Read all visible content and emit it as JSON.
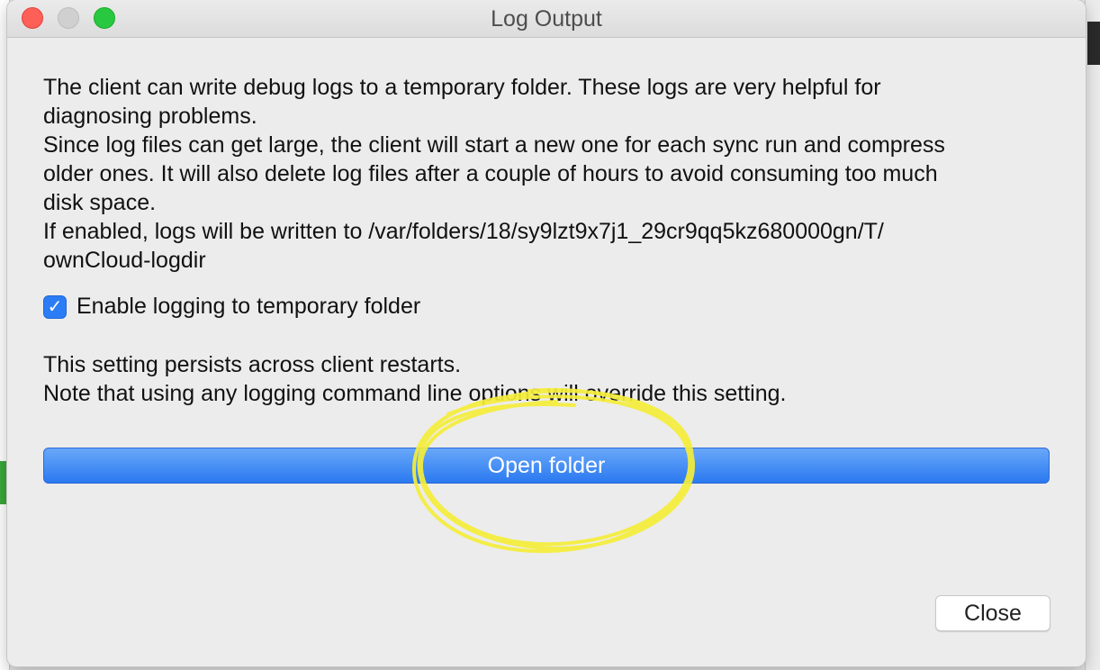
{
  "window": {
    "title": "Log Output"
  },
  "intro_text": "The client can write debug logs to a temporary folder. These logs are very helpful for\ndiagnosing problems.\nSince log files can get large, the client will start a new one for each sync run and compress\nolder ones. It will also delete log files after a couple of hours to avoid consuming too much\ndisk space.\nIf enabled, logs will be written to /var/folders/18/sy9lzt9x7j1_29cr9qq5kz680000gn/T/\nownCloud-logdir",
  "checkbox": {
    "label": "Enable logging to temporary folder",
    "checked": true,
    "icon": "checkmark-icon"
  },
  "persist_text": "This setting persists across client restarts.\nNote that using any logging command line options will override this setting.",
  "buttons": {
    "open_folder": "Open folder",
    "close": "Close"
  },
  "colors": {
    "accent": "#2c7cf5",
    "highlight_annotation": "#f5ee3a",
    "traffic_close": "#fe5f57",
    "traffic_max": "#28c840"
  }
}
